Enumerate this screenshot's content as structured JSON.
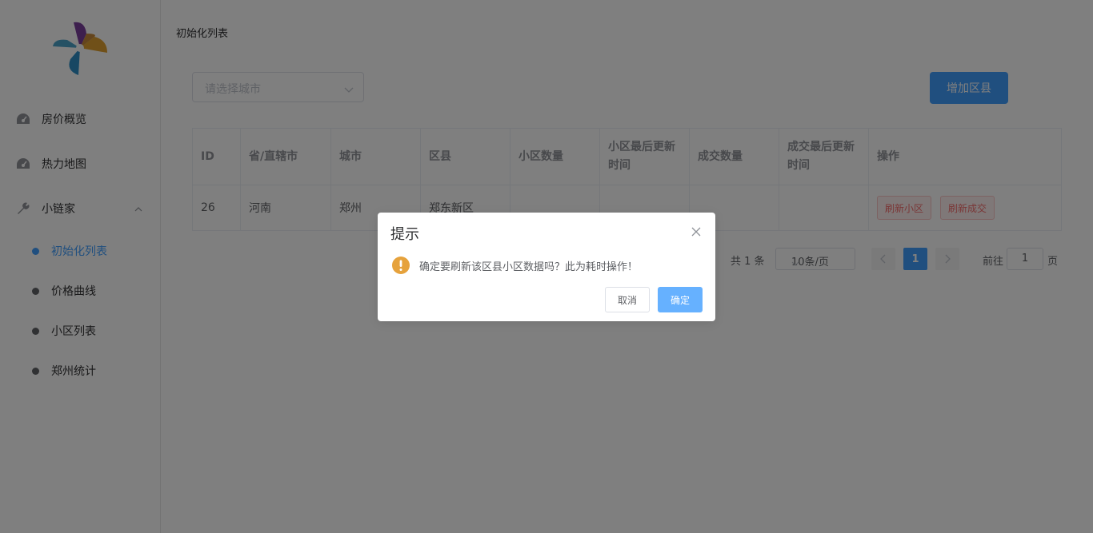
{
  "colors": {
    "primary": "#409EFF",
    "danger": "#f56c6c",
    "warning": "#E6A23C"
  },
  "sidebar": {
    "logo_icon": "pinwheel-logo",
    "items": [
      {
        "label": "房价概览",
        "icon": "dashboard-icon"
      },
      {
        "label": "热力地图",
        "icon": "dashboard-icon"
      },
      {
        "label": "小链家",
        "icon": "wrench-icon"
      }
    ],
    "submenu": [
      {
        "label": "初始化列表",
        "active": true
      },
      {
        "label": "价格曲线"
      },
      {
        "label": "小区列表"
      },
      {
        "label": "郑州统计"
      }
    ]
  },
  "main": {
    "breadcrumb": "初始化列表",
    "city_select": {
      "placeholder": "请选择城市"
    },
    "add_button": "增加区县",
    "table": {
      "columns": [
        "ID",
        "省/直辖市",
        "城市",
        "区县",
        "小区数量",
        "小区最后更新时间",
        "成交数量",
        "成交最后更新时间",
        "操作"
      ],
      "rows": [
        {
          "id": "26",
          "province": "河南",
          "city": "郑州",
          "district": "郑东新区",
          "community_count": "",
          "community_updated": "",
          "deal_count": "",
          "deal_updated": ""
        }
      ],
      "actions": {
        "refresh_community": "刷新小区",
        "refresh_deal": "刷新成交"
      }
    },
    "pagination": {
      "total": "共 1 条",
      "page_size": "10条/页",
      "current_page": "1",
      "goto_label": "前往",
      "goto_value": "1",
      "page_suffix": "页"
    }
  },
  "dialog": {
    "title": "提示",
    "message": "确定要刷新该区县小区数据吗？此为耗时操作！",
    "cancel": "取消",
    "confirm": "确定"
  }
}
